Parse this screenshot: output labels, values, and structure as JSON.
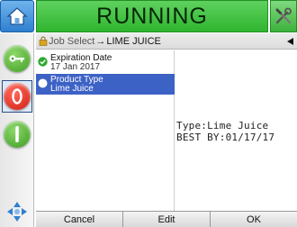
{
  "header": {
    "status": "RUNNING"
  },
  "breadcrumb": {
    "parent": "Job Select",
    "current": "LIME JUICE"
  },
  "list": [
    {
      "title": "Expiration Date",
      "value": "17 Jan 2017",
      "selected": false
    },
    {
      "title": "Product Type",
      "value": "Lime Juice",
      "selected": true
    }
  ],
  "preview": {
    "line1": "Type:Lime Juice",
    "line2": "BEST BY:01/17/17"
  },
  "footer": {
    "cancel_label": "Cancel",
    "edit_label": "Edit",
    "ok_label": "OK"
  },
  "colors": {
    "status_green": "#2fb52f",
    "selection_blue": "#3d62c6",
    "stop_red": "#d11a0e"
  },
  "icons": [
    "home-icon",
    "tools-icon",
    "key-icon",
    "stop-icon",
    "start-icon",
    "navigation-arrows-icon",
    "lock-icon",
    "check-icon",
    "back-arrow-icon"
  ]
}
